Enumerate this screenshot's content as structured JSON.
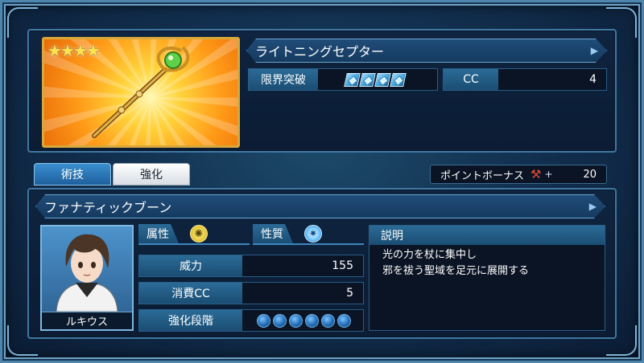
{
  "item": {
    "name": "ライトニングセプター",
    "rarity_stars": 4,
    "limit_break_label": "限界突破",
    "limit_break_level": 4,
    "cc_label": "CC",
    "cc_value": "4"
  },
  "tabs": [
    {
      "label": "術技",
      "active": true
    },
    {
      "label": "強化",
      "active": false
    }
  ],
  "point_bonus": {
    "label": "ポイントボーナス",
    "plus": "+",
    "value": "20"
  },
  "skill": {
    "name": "ファナティックブーン",
    "character_name": "ルキウス",
    "element_label": "属性",
    "element_icon": "light-element-icon",
    "nature_label": "性質",
    "nature_icon": "nature-icon",
    "power_label": "威力",
    "power_value": "155",
    "cost_label": "消費CC",
    "cost_value": "5",
    "enhance_label": "強化段階",
    "enhance_slots": 6,
    "description_label": "説明",
    "description_lines": [
      "光の力を杖に集中し",
      "邪を祓う聖域を足元に展開する"
    ]
  },
  "colors": {
    "accent": "#3d86bd",
    "card_gold": "#d8a93a"
  }
}
